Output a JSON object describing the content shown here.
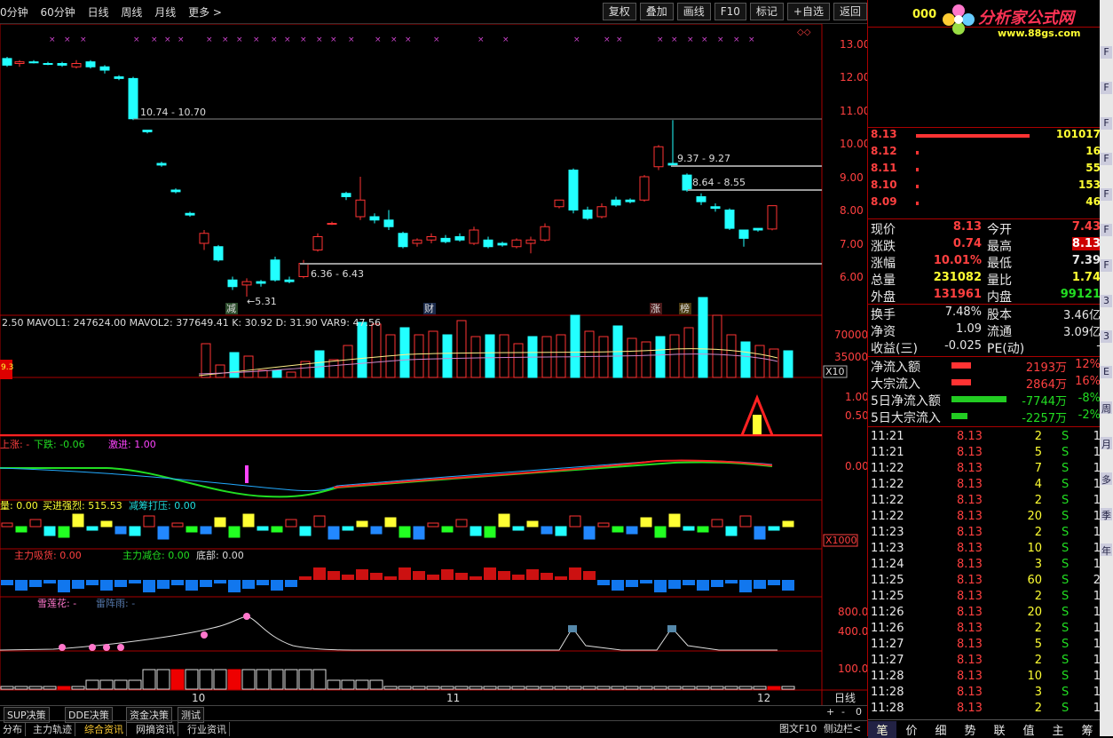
{
  "toolbar": {
    "periods": [
      "0分钟",
      "60分钟",
      "日线",
      "周线",
      "月线",
      "更多 >"
    ],
    "buttons": [
      "复权",
      "叠加",
      "画线",
      "F10",
      "标记",
      "+自选",
      "返回"
    ]
  },
  "brand": {
    "code": "000",
    "logo_text": "分析家公式网",
    "logo_url": "www.88gs.com"
  },
  "price_axis": [
    "13.00",
    "12.00",
    "11.00",
    "10.00",
    "9.00",
    "8.00",
    "7.00",
    "6.00"
  ],
  "annotations": {
    "a1": "10.74 - 10.70",
    "a2": "9.37 - 9.27",
    "a3": "8.64 - 8.55",
    "a4": "6.36 - 6.43",
    "a5": "←5.31",
    "tag_jian": "减",
    "tag_cai": "财",
    "tag_zhang": "涨",
    "tag_bang": "榜"
  },
  "panels": {
    "vol_header": "2.50  MAVOL1: 247624.00  MAVOL2: 377649.41  K: 30.92  D: 31.90  VAR9: 47.56",
    "vol_axis": [
      "70000",
      "35000"
    ],
    "vol_unit": "X10",
    "vol_badge": "9.3",
    "p2_axis": [
      "1.00",
      "0.50"
    ],
    "p3_header": {
      "a": "上涨: -",
      "b": "下跌: -0.06",
      "c": "激进: 1.00"
    },
    "p3_axis": "0.00",
    "p4_header": {
      "a": "量: 0.00",
      "b": "买进强烈: 515.53",
      "c": "减筹打压: 0.00"
    },
    "p4_unit": "X1000",
    "p5_header": {
      "a": "主力吸货: 0.00",
      "b": "主力减仓: 0.00",
      "c": "底部: 0.00"
    },
    "p6_header": {
      "a": "雪莲花: -",
      "b": "雷阵雨: -"
    },
    "p6_axis": [
      "800.0",
      "400.0"
    ],
    "p7_axis": "100.0",
    "date_labels": [
      "10",
      "11",
      "12"
    ],
    "period_label": "日线"
  },
  "quote": {
    "asks": [
      {
        "p": "8.13",
        "v": "101017"
      },
      {
        "p": "8.12",
        "v": "16"
      },
      {
        "p": "8.11",
        "v": "55"
      },
      {
        "p": "8.10",
        "v": "153"
      },
      {
        "p": "8.09",
        "v": "46"
      }
    ],
    "stats": [
      [
        "现价",
        "8.13",
        "今开",
        "7.43"
      ],
      [
        "涨跌",
        "0.74",
        "最高",
        "8.13"
      ],
      [
        "涨幅",
        "10.01%",
        "最低",
        "7.39"
      ],
      [
        "总量",
        "231082",
        "量比",
        "1.74"
      ],
      [
        "外盘",
        "131961",
        "内盘",
        "99121"
      ]
    ],
    "stats2": [
      [
        "换手",
        "7.48%",
        "股本",
        "3.46亿"
      ],
      [
        "净资",
        "1.09",
        "流通",
        "3.09亿"
      ],
      [
        "收益(三)",
        "-0.025",
        "PE(动)",
        "-"
      ]
    ],
    "flows": [
      [
        "净流入额",
        "2193万",
        "12%"
      ],
      [
        "大宗流入",
        "2864万",
        "16%"
      ],
      [
        "5日净流入额",
        "-7744万",
        "-8%"
      ],
      [
        "5日大宗流入",
        "-2257万",
        "-2%"
      ]
    ],
    "ticks": [
      [
        "11:21",
        "8.13",
        "2",
        "S",
        "1"
      ],
      [
        "11:21",
        "8.13",
        "5",
        "S",
        "1"
      ],
      [
        "11:22",
        "8.13",
        "7",
        "S",
        "1"
      ],
      [
        "11:22",
        "8.13",
        "4",
        "S",
        "1"
      ],
      [
        "11:22",
        "8.13",
        "2",
        "S",
        "1"
      ],
      [
        "11:22",
        "8.13",
        "20",
        "S",
        "1"
      ],
      [
        "11:23",
        "8.13",
        "2",
        "S",
        "1"
      ],
      [
        "11:23",
        "8.13",
        "10",
        "S",
        "1"
      ],
      [
        "11:24",
        "8.13",
        "3",
        "S",
        "1"
      ],
      [
        "11:25",
        "8.13",
        "60",
        "S",
        "2"
      ],
      [
        "11:25",
        "8.13",
        "2",
        "S",
        "1"
      ],
      [
        "11:26",
        "8.13",
        "20",
        "S",
        "1"
      ],
      [
        "11:26",
        "8.13",
        "2",
        "S",
        "1"
      ],
      [
        "11:27",
        "8.13",
        "5",
        "S",
        "1"
      ],
      [
        "11:27",
        "8.13",
        "2",
        "S",
        "1"
      ],
      [
        "11:28",
        "8.13",
        "10",
        "S",
        "1"
      ],
      [
        "11:28",
        "8.13",
        "3",
        "S",
        "1"
      ],
      [
        "11:28",
        "8.13",
        "2",
        "S",
        "1"
      ]
    ],
    "bottom_tabs": [
      "笔",
      "价",
      "细",
      "势",
      "联",
      "值",
      "主",
      "筹"
    ]
  },
  "bottom": {
    "row1": [
      "SUP决策",
      "DDE决策",
      "资金决策",
      "测试"
    ],
    "row2": [
      "分布",
      "主力轨迹",
      "综合资讯",
      "网摘资讯",
      "行业资讯"
    ],
    "right": [
      "图文F10",
      "侧边栏<"
    ],
    "zoom": [
      "+",
      "-",
      "0"
    ]
  },
  "side_icons": [
    "F",
    "F",
    "F",
    "F",
    "F",
    "F",
    "F",
    "3",
    "3",
    "E",
    "周",
    "月",
    "多",
    "季",
    "年"
  ]
}
